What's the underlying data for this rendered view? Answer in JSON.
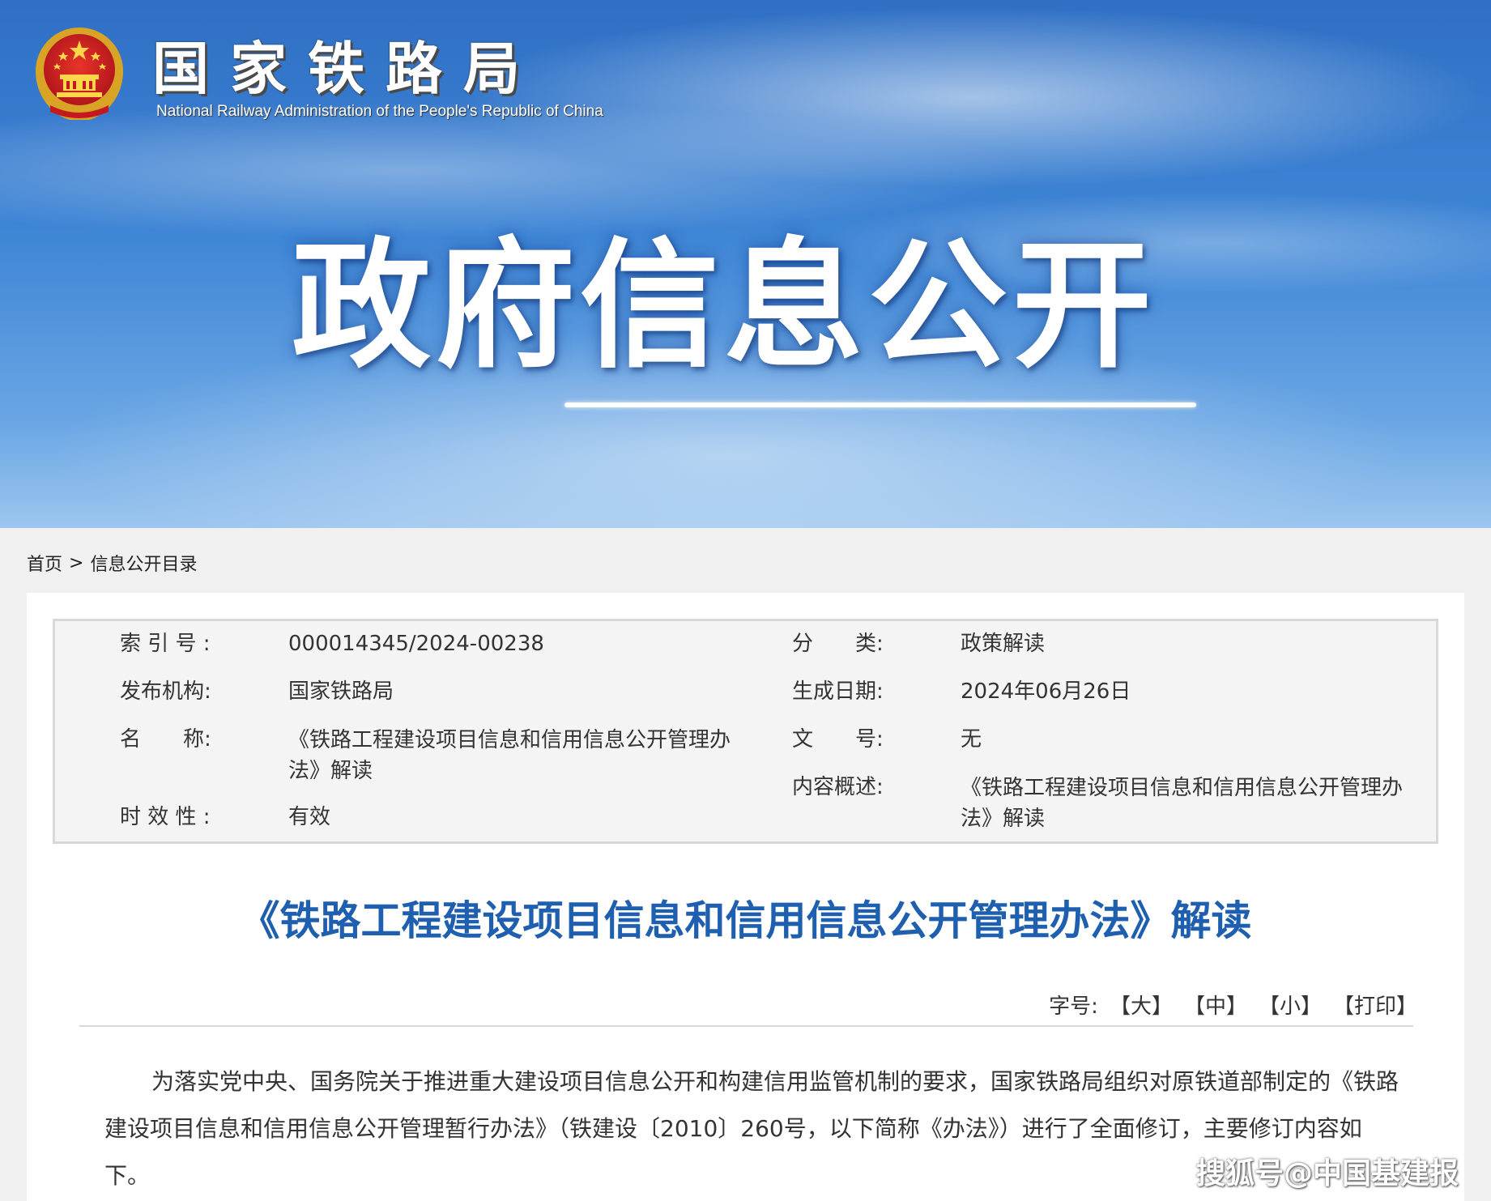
{
  "header": {
    "org_name_cn": "国家铁路局",
    "org_name_en": "National Railway Administration of the People's Republic of China",
    "banner_title": "政府信息公开"
  },
  "breadcrumb": {
    "home": "首页",
    "separator": ">",
    "current": "信息公开目录"
  },
  "meta": {
    "index_label": "索 引 号 :",
    "index_value": "000014345/2024-00238",
    "category_label": "分　　类:",
    "category_value": "政策解读",
    "publisher_label": "发布机构:",
    "publisher_value": "国家铁路局",
    "date_label": "生成日期:",
    "date_value": "2024年06月26日",
    "name_label": "名　　称:",
    "name_value": "《铁路工程建设项目信息和信用信息公开管理办法》解读",
    "docno_label": "文　　号:",
    "docno_value": "无",
    "summary_label": "内容概述:",
    "summary_value": "《铁路工程建设项目信息和信用信息公开管理办法》解读",
    "validity_label": "时 效 性 :",
    "validity_value": "有效"
  },
  "article": {
    "title": "《铁路工程建设项目信息和信用信息公开管理办法》解读",
    "font_size_label": "字号:",
    "font_large": "【大】",
    "font_medium": "【中】",
    "font_small": "【小】",
    "print": "【打印】",
    "paragraph_1": "为落实党中央、国务院关于推进重大建设项目信息公开和构建信用监管机制的要求，国家铁路局组织对原铁道部制定的《铁路建设项目信息和信用信息公开管理暂行办法》（铁建设〔2010〕260号，以下简称《办法》）进行了全面修订，主要修订内容如下。"
  },
  "watermark": "搜狐号@中国基建报",
  "colors": {
    "banner_blue": "#3f86d6",
    "title_blue": "#1f5fb0",
    "meta_bg": "#f4f4f4",
    "page_bg": "#f0f0f0"
  }
}
